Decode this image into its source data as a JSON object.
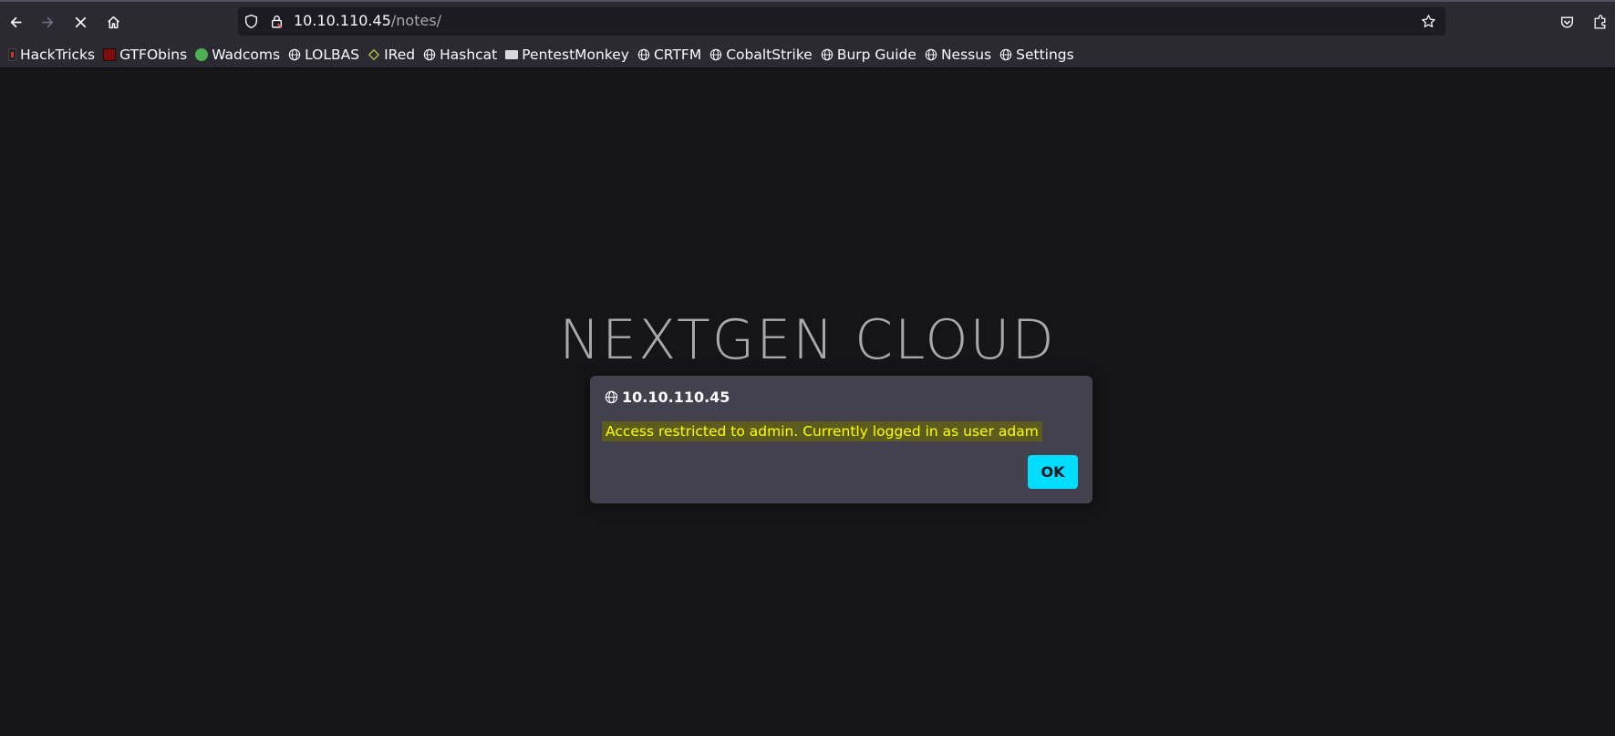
{
  "toolbar": {
    "back_icon": "arrow-left-icon",
    "forward_icon": "arrow-right-icon",
    "stop_icon": "close-icon",
    "home_icon": "home-icon",
    "url_host": "10.10.110.45",
    "url_path": "/notes/",
    "shield_icon": "shield-icon",
    "lock_icon": "lock-icon",
    "bookmark_star_icon": "star-icon",
    "pocket_icon": "pocket-icon",
    "extensions_icon": "extensions-icon"
  },
  "bookmarks": [
    {
      "label": "HackTricks",
      "icon": "hacktricks-icon"
    },
    {
      "label": "GTFObins",
      "icon": "gtfobins-icon"
    },
    {
      "label": "Wadcoms",
      "icon": "wadcoms-icon"
    },
    {
      "label": "LOLBAS",
      "icon": "globe-icon"
    },
    {
      "label": "IRed",
      "icon": "ired-icon"
    },
    {
      "label": "Hashcat",
      "icon": "globe-icon"
    },
    {
      "label": "PentestMonkey",
      "icon": "pentestmonkey-icon"
    },
    {
      "label": "CRTFM",
      "icon": "globe-icon"
    },
    {
      "label": "CobaltStrike",
      "icon": "globe-icon"
    },
    {
      "label": "Burp Guide",
      "icon": "globe-icon"
    },
    {
      "label": "Nessus",
      "icon": "globe-icon"
    },
    {
      "label": "Settings",
      "icon": "globe-icon"
    }
  ],
  "page": {
    "heading": "NEXTGEN CLOUD"
  },
  "dialog": {
    "origin": "10.10.110.45",
    "message": "Access restricted to admin. Currently logged in as user adam",
    "ok_label": "OK"
  },
  "colors": {
    "toolbar_bg": "#2b2a33",
    "page_bg": "#151517",
    "dialog_bg": "#42414d",
    "accent": "#00ddff",
    "highlight_text": "#ffff00"
  }
}
